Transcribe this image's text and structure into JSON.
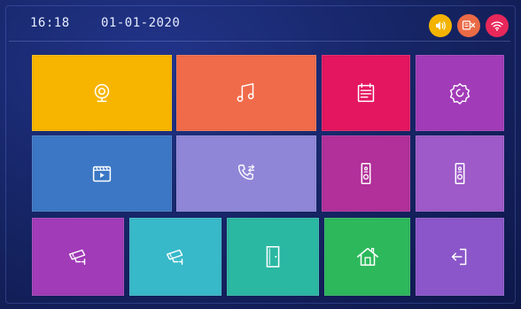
{
  "status_bar": {
    "time": "16:18",
    "date": "01-01-2020",
    "icons": [
      {
        "name": "speaker-icon",
        "color": "#f3b300"
      },
      {
        "name": "video-record-off-icon",
        "color": "#ea6a46"
      },
      {
        "name": "wifi-icon",
        "color": "#e8275a"
      }
    ]
  },
  "tiles": [
    {
      "icon": "webcam-icon",
      "color": "#f7b500"
    },
    {
      "icon": "music-icon",
      "color": "#f06b4a"
    },
    {
      "icon": "notepad-icon",
      "color": "#e3165f"
    },
    {
      "icon": "settings-gear-icon",
      "color": "#a13bb7"
    },
    {
      "icon": "video-clip-icon",
      "color": "#3b77c4"
    },
    {
      "icon": "phone-call-icon",
      "color": "#8f86d8"
    },
    {
      "icon": "door-station-icon",
      "color": "#b1309a"
    },
    {
      "icon": "door-station-icon",
      "color": "#9d5ac8"
    },
    {
      "icon": "cctv-camera-icon",
      "color": "#a13bb7"
    },
    {
      "icon": "cctv-camera-icon",
      "color": "#38b9c9"
    },
    {
      "icon": "door-icon",
      "color": "#2bb8a3"
    },
    {
      "icon": "home-icon",
      "color": "#2db85c"
    },
    {
      "icon": "logout-icon",
      "color": "#8b56c9"
    }
  ]
}
